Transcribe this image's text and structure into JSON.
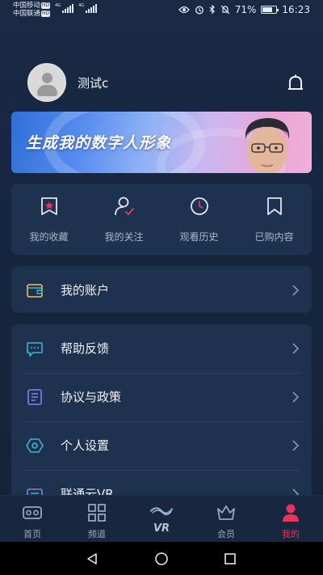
{
  "status_bar": {
    "carrier1": "中国移动",
    "carrier2": "中国联通",
    "hd": "HD",
    "net1": "4G",
    "net2": "4G",
    "battery_pct": "71%",
    "time": "16:23"
  },
  "profile": {
    "username": "测试c"
  },
  "banner": {
    "text": "生成我的数字人形象"
  },
  "shortcuts": [
    {
      "label": "我的收藏",
      "icon": "bookmark-star-icon"
    },
    {
      "label": "我的关注",
      "icon": "user-check-icon"
    },
    {
      "label": "观看历史",
      "icon": "clock-icon"
    },
    {
      "label": "已购内容",
      "icon": "bookmark-icon"
    }
  ],
  "account": {
    "label": "我的账户",
    "icon": "wallet-icon"
  },
  "menu": [
    {
      "label": "帮助反馈",
      "icon": "chat-icon"
    },
    {
      "label": "协议与政策",
      "icon": "document-icon"
    },
    {
      "label": "个人设置",
      "icon": "settings-hexagon-icon"
    },
    {
      "label": "联通云VR",
      "icon": "vr-icon"
    }
  ],
  "bottom_nav": [
    {
      "label": "首页",
      "icon": "vr-headset-icon"
    },
    {
      "label": "频道",
      "icon": "grid-icon"
    },
    {
      "label": "VR",
      "icon": "vr-logo-icon"
    },
    {
      "label": "会员",
      "icon": "crown-icon"
    },
    {
      "label": "我的",
      "icon": "person-icon",
      "active": true
    }
  ],
  "colors": {
    "background": "#16243a",
    "card": "#1e3250",
    "accent_red": "#e8345a",
    "accent_cyan": "#38b6d6",
    "accent_purple": "#8a7cf0"
  }
}
